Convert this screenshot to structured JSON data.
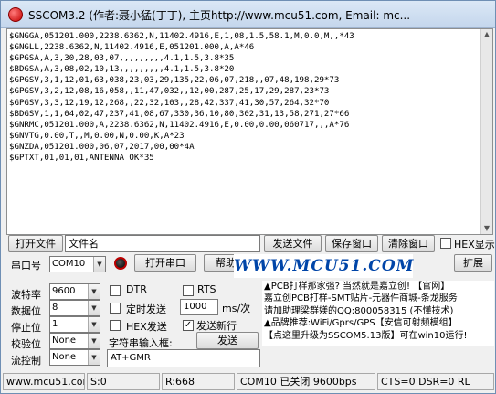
{
  "window": {
    "title": "SSCOM3.2 (作者:聂小猛(丁丁), 主页http://www.mcu51.com,  Email: mc..."
  },
  "output": {
    "lines": [
      "$GNGGA,051201.000,2238.6362,N,11402.4916,E,1,08,1.5,58.1,M,0.0,M,,*43",
      "$GNGLL,2238.6362,N,11402.4916,E,051201.000,A,A*46",
      "$GPGSA,A,3,30,28,03,07,,,,,,,,,4.1,1.5,3.8*35",
      "$BDGSA,A,3,08,02,10,13,,,,,,,,,4.1,1.5,3.8*20",
      "$GPGSV,3,1,12,01,63,038,23,03,29,135,22,06,07,218,,07,48,198,29*73",
      "$GPGSV,3,2,12,08,16,058,,11,47,032,,12,00,287,25,17,29,287,23*73",
      "$GPGSV,3,3,12,19,12,268,,22,32,103,,28,42,337,41,30,57,264,32*70",
      "$BDGSV,1,1,04,02,47,237,41,08,67,330,36,10,80,302,31,13,58,271,27*66",
      "$GNRMC,051201.000,A,2238.6362,N,11402.4916,E,0.00,0.00,060717,,,A*76",
      "$GNVTG,0.00,T,,M,0.00,N,0.00,K,A*23",
      "$GNZDA,051201.000,06,07,2017,00,00*4A",
      "$GPTXT,01,01,01,ANTENNA OK*35"
    ]
  },
  "toolbar": {
    "open_file": "打开文件",
    "filename": "文件名",
    "send_file": "发送文件",
    "save_window": "保存窗口",
    "clear_window": "清除窗口",
    "hex_display": "HEX显示"
  },
  "port": {
    "label": "串口号",
    "value": "COM10",
    "open_button": "打开串口",
    "help_button": "帮助",
    "banner": "WWW.MCU51.COM",
    "expand_button": "扩展"
  },
  "settings": {
    "baud_label": "波特率",
    "baud_value": "9600",
    "databits_label": "数据位",
    "databits_value": "8",
    "stopbits_label": "停止位",
    "stopbits_value": "1",
    "parity_label": "校验位",
    "parity_value": "None",
    "flow_label": "流控制",
    "flow_value": "None"
  },
  "options": {
    "dtr": "DTR",
    "rts": "RTS",
    "timed_send": "定时发送",
    "interval_value": "1000",
    "interval_unit": "ms/次",
    "hex_send": "HEX发送",
    "send_newline": "发送新行",
    "input_label": "字符串输入框:",
    "send_button": "发送",
    "input_value": "AT+GMR"
  },
  "ad": {
    "lines": [
      "▲PCB打样那家强? 当然就是嘉立创! 【官网】",
      "嘉立创PCB打样-SMT贴片-元器件商城-条龙服务",
      "请加助理梁群媄的QQ:800058315 (不懂技术)",
      "▲品牌推荐:WiFi/Gprs/GPS【安信可射频模组】",
      "【点这里升级为SSCOM5.13版】可在win10运行!"
    ]
  },
  "status": {
    "url": "www.mcu51.cor",
    "sent": "S:0",
    "received": "R:668",
    "port_status": "COM10 已关闭  9600bps",
    "lines": "CTS=0 DSR=0 RL"
  }
}
